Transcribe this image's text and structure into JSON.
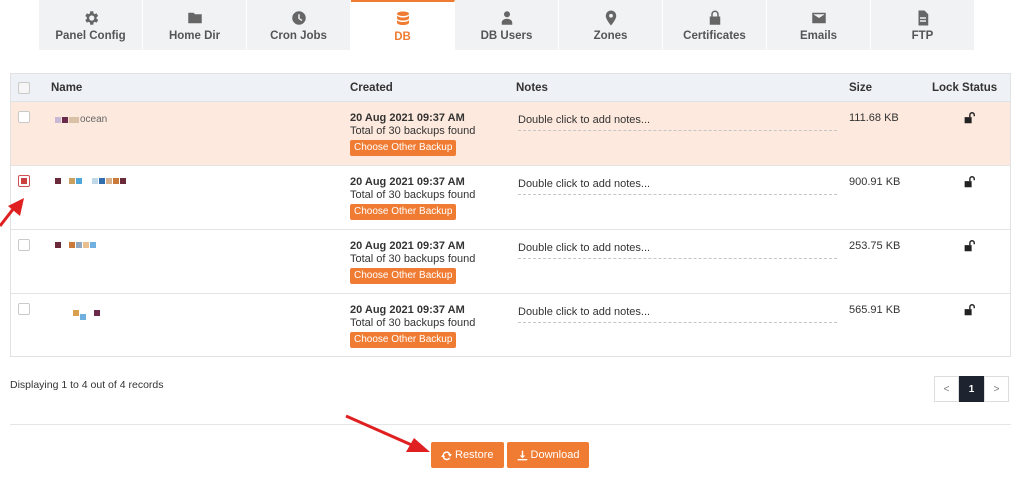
{
  "tabs": [
    {
      "label": "Panel Config",
      "icon": "gear-icon"
    },
    {
      "label": "Home Dir",
      "icon": "folder-icon"
    },
    {
      "label": "Cron Jobs",
      "icon": "clock-icon"
    },
    {
      "label": "DB",
      "icon": "database-icon",
      "active": true
    },
    {
      "label": "DB Users",
      "icon": "users-icon"
    },
    {
      "label": "Zones",
      "icon": "map-marker-icon"
    },
    {
      "label": "Certificates",
      "icon": "lock-icon"
    },
    {
      "label": "Emails",
      "icon": "envelope-icon"
    },
    {
      "label": "FTP",
      "icon": "file-icon"
    }
  ],
  "table": {
    "headers": {
      "name": "Name",
      "created": "Created",
      "notes": "Notes",
      "size": "Size",
      "lock": "Lock Status"
    },
    "rows": [
      {
        "name": "ocean",
        "date": "20 Aug 2021 09:37 AM",
        "total": "Total of 30 backups found",
        "choose": "Choose Other Backup",
        "notes": "Double click to add notes...",
        "size": "111.68 KB",
        "checked": false
      },
      {
        "name": "",
        "date": "20 Aug 2021 09:37 AM",
        "total": "Total of 30 backups found",
        "choose": "Choose Other Backup",
        "notes": "Double click to add notes...",
        "size": "900.91 KB",
        "checked": true
      },
      {
        "name": "",
        "date": "20 Aug 2021 09:37 AM",
        "total": "Total of 30 backups found",
        "choose": "Choose Other Backup",
        "notes": "Double click to add notes...",
        "size": "253.75 KB",
        "checked": false
      },
      {
        "name": "",
        "date": "20 Aug 2021 09:37 AM",
        "total": "Total of 30 backups found",
        "choose": "Choose Other Backup",
        "notes": "Double click to add notes...",
        "size": "565.91 KB",
        "checked": false
      }
    ]
  },
  "footer": {
    "records": "Displaying 1 to 4 out of 4 records",
    "pager": {
      "prev": "<",
      "current": "1",
      "next": ">"
    }
  },
  "actions": {
    "restore": "Restore",
    "download": "Download"
  },
  "colors": {
    "accent": "#f07c33",
    "highlight_row": "#fde9dd",
    "annotation_arrow": "#e02020"
  }
}
